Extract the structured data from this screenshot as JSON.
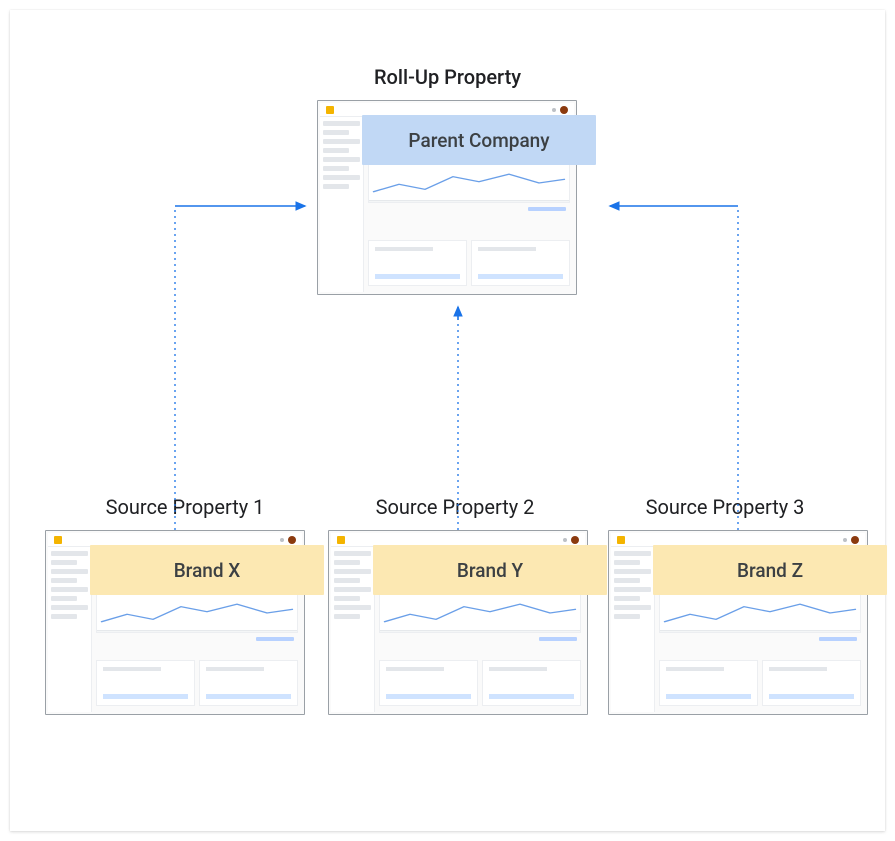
{
  "parent": {
    "title": "Roll-Up Property",
    "badge": "Parent Company"
  },
  "sources": [
    {
      "title": "Source Property 1",
      "badge": "Brand  X"
    },
    {
      "title": "Source Property 2",
      "badge": "Brand Y"
    },
    {
      "title": "Source Property 3",
      "badge": "Brand Z"
    }
  ],
  "colors": {
    "parent_badge": "#c1d8f5",
    "source_badge": "#fce8b2",
    "arrow": "#1a73e8"
  }
}
